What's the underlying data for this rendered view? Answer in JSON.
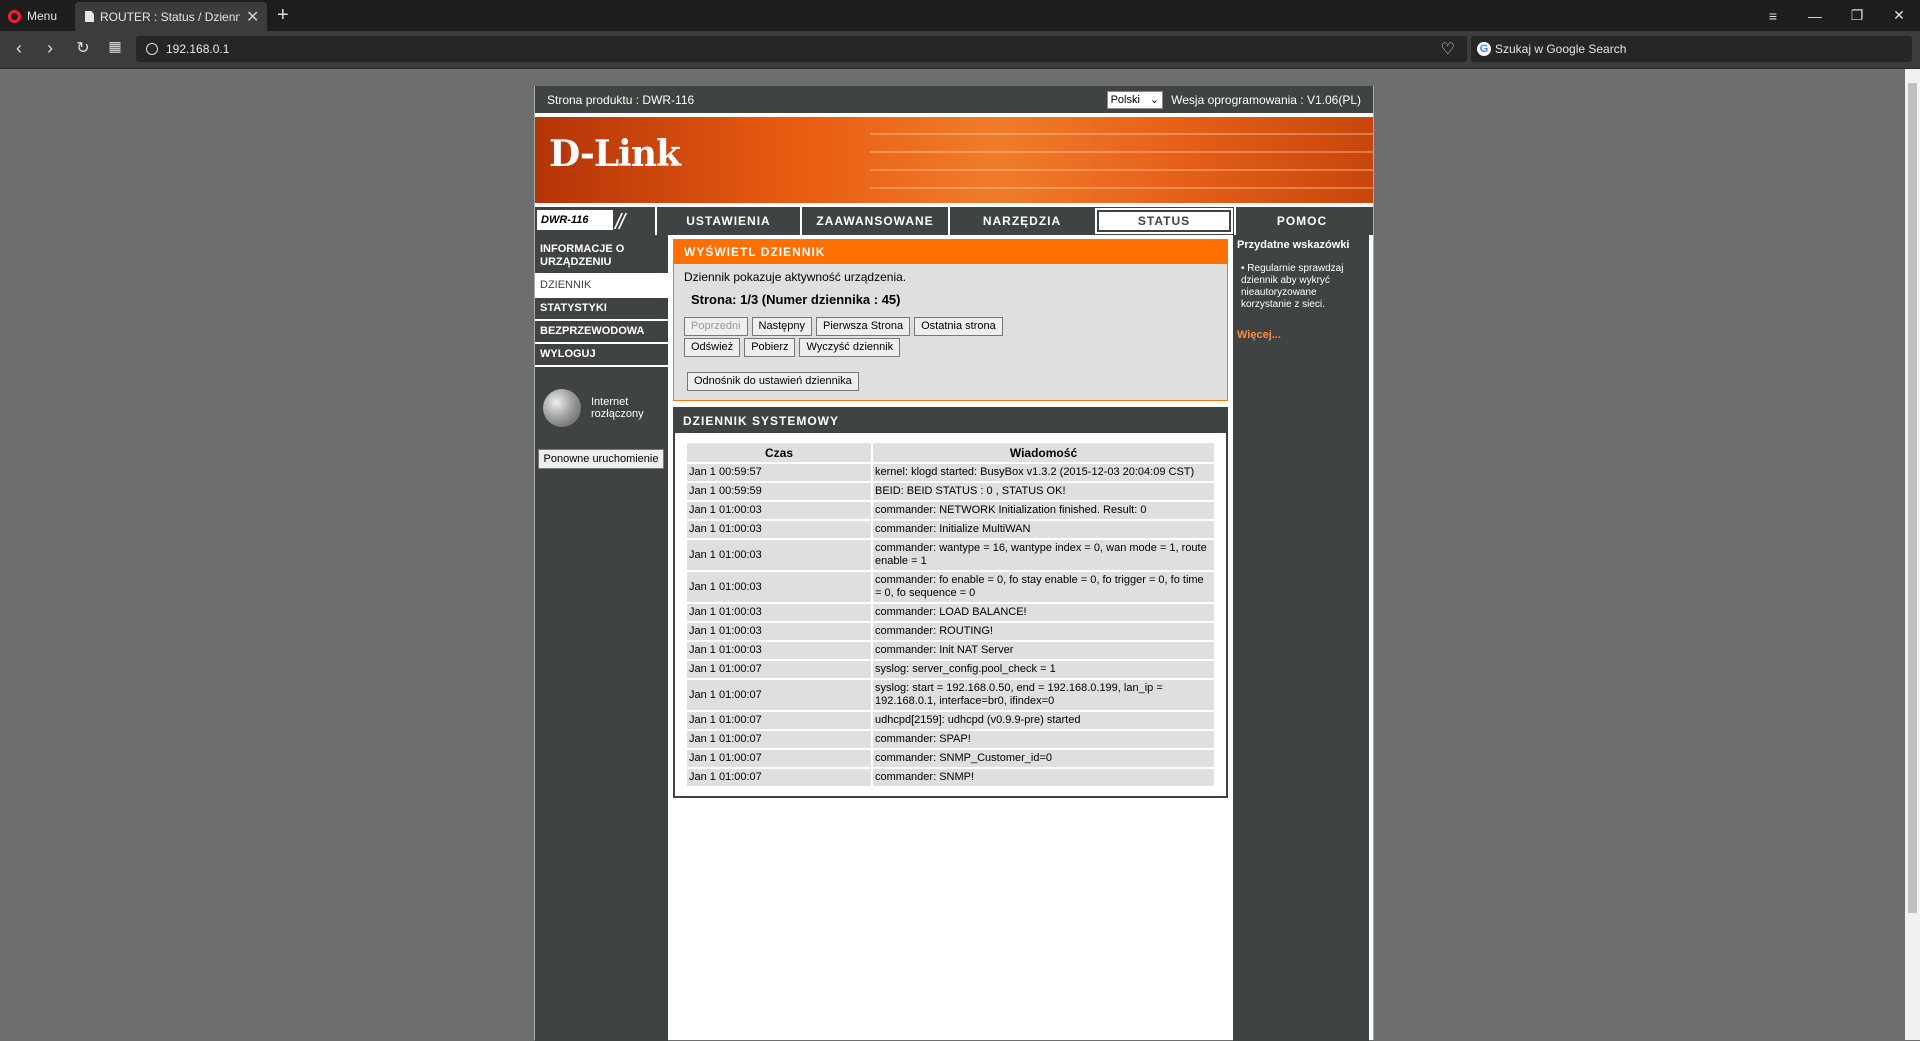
{
  "browser": {
    "menu_label": "Menu",
    "tab_title": "ROUTER : Status / Dziennik",
    "url": "192.168.0.1",
    "search_placeholder": "Szukaj w Google Search"
  },
  "router": {
    "product_label": "Strona produktu :  DWR-116",
    "language": "Polski",
    "firmware_label": "Wesja oprogramowania : V1.06(PL)",
    "logo_text": "D-Link",
    "model": "DWR-116",
    "nav": {
      "tabs": [
        {
          "label": "USTAWIENIA"
        },
        {
          "label": "ZAAWANSOWANE"
        },
        {
          "label": "NARZĘDZIA"
        },
        {
          "label": "STATUS"
        },
        {
          "label": "POMOC"
        }
      ]
    },
    "sidebar": {
      "items": [
        {
          "label": "INFORMACJE O URZĄDZENIU"
        },
        {
          "label": "DZIENNIK"
        },
        {
          "label": "STATYSTYKI"
        },
        {
          "label": "BEZPRZEWODOWA"
        },
        {
          "label": "WYLOGUJ"
        }
      ],
      "internet_status_line1": "Internet",
      "internet_status_line2": "rozłączony",
      "reboot_label": "Ponowne uruchomienie"
    },
    "log_view": {
      "title": "WYŚWIETL DZIENNIK",
      "description": "Dziennik pokazuje aktywność urządzenia.",
      "page_info": "Strona: 1/3 (Numer dziennika : 45)",
      "buttons": {
        "prev": "Poprzedni",
        "next": "Następny",
        "first": "Pierwsza Strona",
        "last": "Ostatnia strona",
        "refresh": "Odśwież",
        "download": "Pobierz",
        "clear": "Wyczyść dziennik",
        "settings_link": "Odnośnik do ustawień dziennika"
      }
    },
    "system_log": {
      "title": "DZIENNIK SYSTEMOWY",
      "col_time": "Czas",
      "col_message": "Wiadomość",
      "rows": [
        {
          "time": "Jan 1 00:59:57",
          "msg": "kernel: klogd started: BusyBox v1.3.2 (2015-12-03 20:04:09 CST)"
        },
        {
          "time": "Jan 1 00:59:59",
          "msg": "BEID: BEID STATUS : 0 , STATUS OK!"
        },
        {
          "time": "Jan 1 01:00:03",
          "msg": "commander: NETWORK Initialization finished. Result: 0"
        },
        {
          "time": "Jan 1 01:00:03",
          "msg": "commander: Initialize MultiWAN"
        },
        {
          "time": "Jan 1 01:00:03",
          "msg": "commander: wantype = 16, wantype index = 0, wan mode = 1, route enable = 1"
        },
        {
          "time": "Jan 1 01:00:03",
          "msg": "commander: fo enable = 0, fo stay enable = 0, fo trigger = 0, fo time = 0, fo sequence = 0"
        },
        {
          "time": "Jan 1 01:00:03",
          "msg": "commander: LOAD BALANCE!"
        },
        {
          "time": "Jan 1 01:00:03",
          "msg": "commander: ROUTING!"
        },
        {
          "time": "Jan 1 01:00:03",
          "msg": "commander: Init NAT Server"
        },
        {
          "time": "Jan 1 01:00:07",
          "msg": "syslog: server_config.pool_check = 1"
        },
        {
          "time": "Jan 1 01:00:07",
          "msg": "syslog: start = 192.168.0.50, end = 192.168.0.199, lan_ip = 192.168.0.1, interface=br0, ifindex=0"
        },
        {
          "time": "Jan 1 01:00:07",
          "msg": "udhcpd[2159]: udhcpd (v0.9.9-pre) started"
        },
        {
          "time": "Jan 1 01:00:07",
          "msg": "commander: SPAP!"
        },
        {
          "time": "Jan 1 01:00:07",
          "msg": "commander: SNMP_Customer_id=0"
        },
        {
          "time": "Jan 1 01:00:07",
          "msg": "commander: SNMP!"
        }
      ]
    },
    "hints": {
      "title": "Przydatne wskazówki",
      "text": "•  Regularnie sprawdzaj dziennik aby wykryć nieautoryzowane korzystanie z sieci.",
      "more": "Więcej..."
    }
  }
}
